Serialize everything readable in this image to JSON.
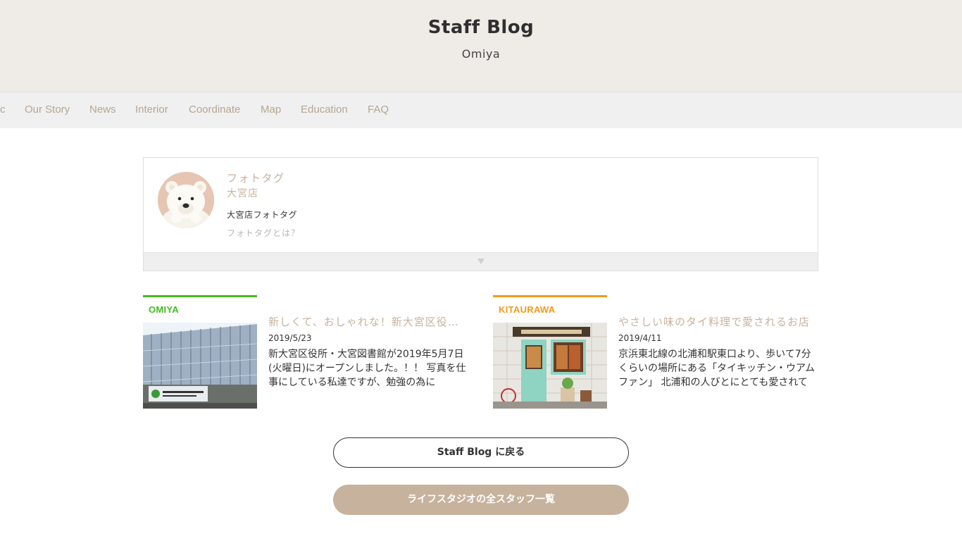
{
  "header": {
    "title": "Staff Blog",
    "subtitle": "Omiya"
  },
  "nav": {
    "items": [
      {
        "label": "c"
      },
      {
        "label": "Our Story"
      },
      {
        "label": "News"
      },
      {
        "label": "Interior"
      },
      {
        "label": "Coordinate"
      },
      {
        "label": "Map"
      },
      {
        "label": "Education"
      },
      {
        "label": "FAQ"
      }
    ]
  },
  "profile": {
    "name": "フォトタグ",
    "store": "大宮店",
    "description": "大宮店フォトタグ",
    "about_link": "フォトタグとは？",
    "avatar_icon": "polar-bear-avatar-icon",
    "expand_icon": "chevron-down-icon"
  },
  "posts": [
    {
      "tag": "OMIYA",
      "tag_color": "#44bb22",
      "title": "新しくて、おしゃれな！新大宮区役所・大宮図書館",
      "date": "2019/5/23",
      "excerpt": "新大宮区役所・大宮図書館が2019年5月7日(火曜日)にオープンしました。！！ 写真を仕事にしている私達ですが、勉強の為に",
      "thumb_icon": "office-building-photo"
    },
    {
      "tag": "KITAURAWA",
      "tag_color": "#f09a1a",
      "title": "やさしい味のタイ料理で愛されるお店",
      "date": "2019/4/11",
      "excerpt": "京浜東北線の北浦和駅東口より、歩いて7分くらいの場所にある「タイキッチン・ウアムファン」 北浦和の人びとにとても愛されて",
      "thumb_icon": "shop-front-photo"
    }
  ],
  "buttons": {
    "back": "Staff Blog に戻る",
    "all_staff": "ライフスタジオの全スタッフ一覧"
  },
  "colors": {
    "header_bg": "#efebe7",
    "accent": "#c7b29d",
    "nav_bg": "#f0f0f0"
  }
}
